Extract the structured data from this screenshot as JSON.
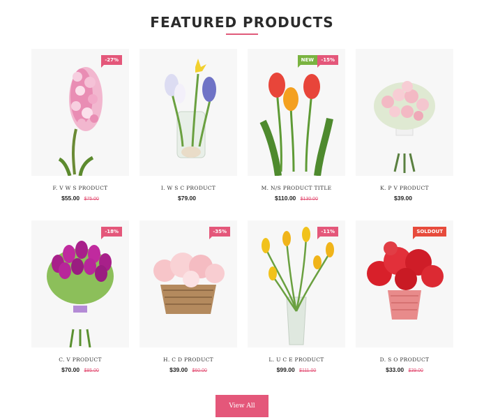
{
  "section": {
    "title": "FEATURED PRODUCTS",
    "view_all_label": "View All"
  },
  "colors": {
    "accent": "#e4577a",
    "new_badge": "#7ab340",
    "soldout_badge": "#e74b3c"
  },
  "products": [
    {
      "name": "F. V W S PRODUCT",
      "price": "$55.00",
      "old_price": "$75.00",
      "badges": [
        "-27%"
      ],
      "image": "pink-hyacinth"
    },
    {
      "name": "I. W S C PRODUCT",
      "price": "$79.00",
      "old_price": "",
      "badges": [],
      "image": "bulbs-in-vase"
    },
    {
      "name": "M. N/S PRODUCT TITLE",
      "price": "$110.00",
      "old_price": "$130.00",
      "badges": [
        "NEW",
        "-15%"
      ],
      "image": "red-tulips"
    },
    {
      "name": "K. P V PRODUCT",
      "price": "$39.00",
      "old_price": "",
      "badges": [],
      "image": "rose-bouquet"
    },
    {
      "name": "C. V PRODUCT",
      "price": "$70.00",
      "old_price": "$85.00",
      "badges": [
        "-18%"
      ],
      "image": "purple-tulips"
    },
    {
      "name": "H. C D PRODUCT",
      "price": "$39.00",
      "old_price": "$60.00",
      "badges": [
        "-35%"
      ],
      "image": "roses-basket"
    },
    {
      "name": "L. U C E PRODUCT",
      "price": "$99.00",
      "old_price": "$111.00",
      "badges": [
        "-11%"
      ],
      "image": "yellow-tulips-vase"
    },
    {
      "name": "D. S O PRODUCT",
      "price": "$33.00",
      "old_price": "$39.00",
      "badges": [
        "SOLDOUT"
      ],
      "image": "red-roses-pot"
    }
  ]
}
